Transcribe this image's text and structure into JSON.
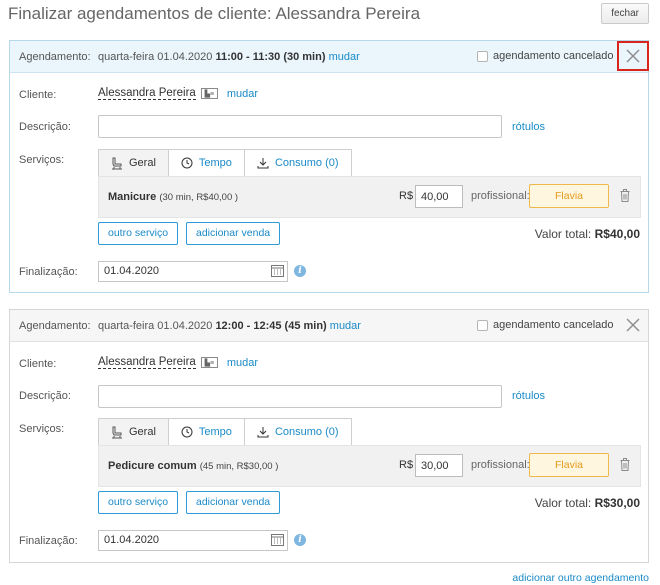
{
  "page": {
    "title": "Finalizar agendamentos de cliente: Alessandra Pereira",
    "close_label": "fechar",
    "add_another_label": "adicionar outro agendamento"
  },
  "labels": {
    "agendamento": "Agendamento:",
    "cliente": "Cliente:",
    "descricao": "Descrição:",
    "servicos": "Serviços:",
    "finalizacao": "Finalização:",
    "mudar": "mudar",
    "cancelado": "agendamento cancelado",
    "rotulos": "rótulos",
    "currency": "R$",
    "profissional": "profissional:",
    "outro_servico": "outro serviço",
    "adicionar_venda": "adicionar venda",
    "valor_total": "Valor total:"
  },
  "tabs": [
    {
      "label": "Geral",
      "icon": "chair-icon"
    },
    {
      "label": "Tempo",
      "icon": "clock-icon"
    },
    {
      "label": "Consumo (0)",
      "icon": "download-icon"
    }
  ],
  "appointments": [
    {
      "date": "quarta-feira 01.04.2020",
      "time": "11:00 - 11:30 (30 min)",
      "client": "Alessandra Pereira",
      "description": "",
      "service_name": "Manicure",
      "service_details": "(30 min, R$40,00 )",
      "price": "40,00",
      "professional": "Flavia",
      "total": "R$40,00",
      "finalization_date": "01.04.2020"
    },
    {
      "date": "quarta-feira 01.04.2020",
      "time": "12:00 - 12:45 (45 min)",
      "client": "Alessandra Pereira",
      "description": "",
      "service_name": "Pedicure comum",
      "service_details": "(45 min, R$30,00 )",
      "price": "30,00",
      "professional": "Flavia",
      "total": "R$30,00",
      "finalization_date": "01.04.2020"
    }
  ],
  "colors": {
    "link": "#1a8ac8",
    "active_header": "#eaf5fc",
    "professional_bg": "#fff6df",
    "professional_border": "#f0b74b",
    "highlight_red": "#d9261c"
  }
}
